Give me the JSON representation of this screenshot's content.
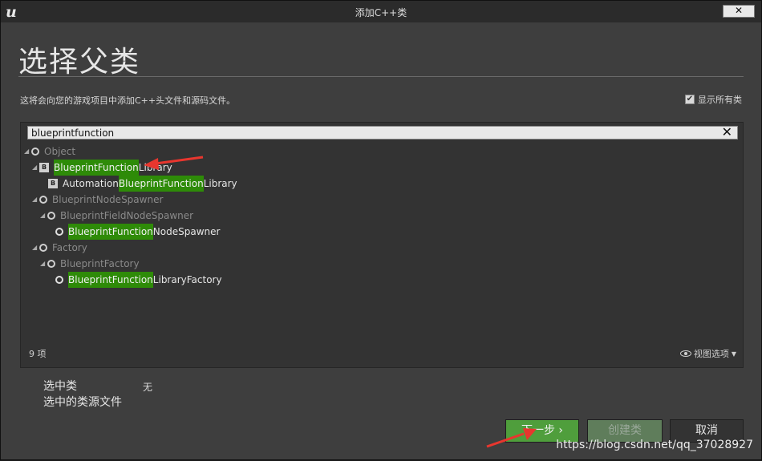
{
  "window": {
    "title": "添加C++类",
    "close_label": "✕",
    "logo": "u"
  },
  "header": {
    "title": "选择父类",
    "description": "这将会向您的游戏项目中添加C++头文件和源码文件。",
    "show_all_label": "显示所有类",
    "show_all_checked": true
  },
  "search": {
    "value": "blueprintfunction",
    "clear_label": "✕"
  },
  "tree": {
    "rows": [
      {
        "pre": "",
        "hl": "",
        "post": "Object",
        "icon": "class",
        "dim": true,
        "expanded": true
      },
      {
        "pre": "",
        "hl": "BlueprintFunction",
        "post": "Library",
        "icon": "blueprint"
      },
      {
        "pre": "Automation",
        "hl": "BlueprintFunction",
        "post": "Library",
        "icon": "blueprint"
      },
      {
        "pre": "",
        "hl": "",
        "post": "BlueprintNodeSpawner",
        "icon": "class",
        "dim": true,
        "expanded": true
      },
      {
        "pre": "",
        "hl": "",
        "post": "BlueprintFieldNodeSpawner",
        "icon": "class",
        "dim": true,
        "expanded": true
      },
      {
        "pre": "",
        "hl": "BlueprintFunction",
        "post": "NodeSpawner",
        "icon": "class"
      },
      {
        "pre": "",
        "hl": "",
        "post": "Factory",
        "icon": "class",
        "dim": true,
        "expanded": true
      },
      {
        "pre": "",
        "hl": "",
        "post": "BlueprintFactory",
        "icon": "class",
        "dim": true,
        "expanded": true
      },
      {
        "pre": "",
        "hl": "BlueprintFunction",
        "post": "LibraryFactory",
        "icon": "class"
      }
    ]
  },
  "footer": {
    "count": "9 项",
    "view_options": "视图选项"
  },
  "info": {
    "selected_class_label": "选中类",
    "selected_class_value": "无",
    "source_file_label": "选中的类源文件"
  },
  "buttons": {
    "next": "下一步",
    "create": "创建类",
    "cancel": "取消"
  },
  "watermark": "https://blog.csdn.net/qq_37028927",
  "colors": {
    "highlight": "#2e8b08",
    "next_button": "#4f9e3c",
    "annotation_arrow": "#e8362e"
  }
}
